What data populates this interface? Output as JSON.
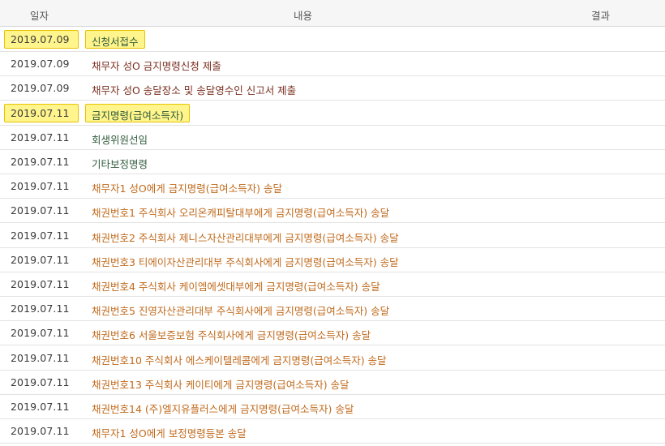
{
  "header": {
    "date": "일자",
    "content": "내용",
    "result": "결과"
  },
  "colors": {
    "dark": "#3a3a3a",
    "maroon": "#7a2f20",
    "green": "#2f5a3b",
    "orange": "#c06a1c",
    "highlight": "#fff58c"
  },
  "rows": [
    {
      "date": "2019.07.09",
      "content": "신청서접수",
      "result": "",
      "highlight": true,
      "content_color": "green"
    },
    {
      "date": "2019.07.09",
      "content": "채무자 성O 금지명령신청 제출",
      "result": "",
      "highlight": false,
      "content_color": "maroon"
    },
    {
      "date": "2019.07.09",
      "content": "채무자 성O 송달장소 및 송달영수인 신고서 제출",
      "result": "",
      "highlight": false,
      "content_color": "maroon"
    },
    {
      "date": "2019.07.11",
      "content": "금지명령(급여소득자)",
      "result": "",
      "highlight": true,
      "content_color": "green"
    },
    {
      "date": "2019.07.11",
      "content": "회생위원선임",
      "result": "",
      "highlight": false,
      "content_color": "green"
    },
    {
      "date": "2019.07.11",
      "content": "기타보정명령",
      "result": "",
      "highlight": false,
      "content_color": "green"
    },
    {
      "date": "2019.07.11",
      "content": "채무자1 성O에게 금지명령(급여소득자) 송달",
      "result": "",
      "highlight": false,
      "content_color": "orange"
    },
    {
      "date": "2019.07.11",
      "content": "채권번호1 주식회사 오리온캐피탈대부에게 금지명령(급여소득자) 송달",
      "result": "",
      "highlight": false,
      "content_color": "orange"
    },
    {
      "date": "2019.07.11",
      "content": "채권번호2 주식회사 제니스자산관리대부에게 금지명령(급여소득자) 송달",
      "result": "",
      "highlight": false,
      "content_color": "orange"
    },
    {
      "date": "2019.07.11",
      "content": "채권번호3 티에이자산관리대부 주식회사에게 금지명령(급여소득자) 송달",
      "result": "",
      "highlight": false,
      "content_color": "orange"
    },
    {
      "date": "2019.07.11",
      "content": "채권번호4 주식회사 케이엠에셋대부에게 금지명령(급여소득자) 송달",
      "result": "",
      "highlight": false,
      "content_color": "orange"
    },
    {
      "date": "2019.07.11",
      "content": "채권번호5 진영자산관리대부 주식회사에게 금지명령(급여소득자) 송달",
      "result": "",
      "highlight": false,
      "content_color": "orange"
    },
    {
      "date": "2019.07.11",
      "content": "채권번호6 서울보증보험 주식회사에게 금지명령(급여소득자) 송달",
      "result": "",
      "highlight": false,
      "content_color": "orange"
    },
    {
      "date": "2019.07.11",
      "content": "채권번호10 주식회사 에스케이텔레콤에게 금지명령(급여소득자) 송달",
      "result": "",
      "highlight": false,
      "content_color": "orange"
    },
    {
      "date": "2019.07.11",
      "content": "채권번호13 주식회사 케이티에게 금지명령(급여소득자) 송달",
      "result": "",
      "highlight": false,
      "content_color": "orange"
    },
    {
      "date": "2019.07.11",
      "content": "채권번호14 (주)엘지유플러스에게 금지명령(급여소득자) 송달",
      "result": "",
      "highlight": false,
      "content_color": "orange"
    },
    {
      "date": "2019.07.11",
      "content": "채무자1 성O에게 보정명령등본 송달",
      "result": "",
      "highlight": false,
      "content_color": "orange"
    }
  ]
}
